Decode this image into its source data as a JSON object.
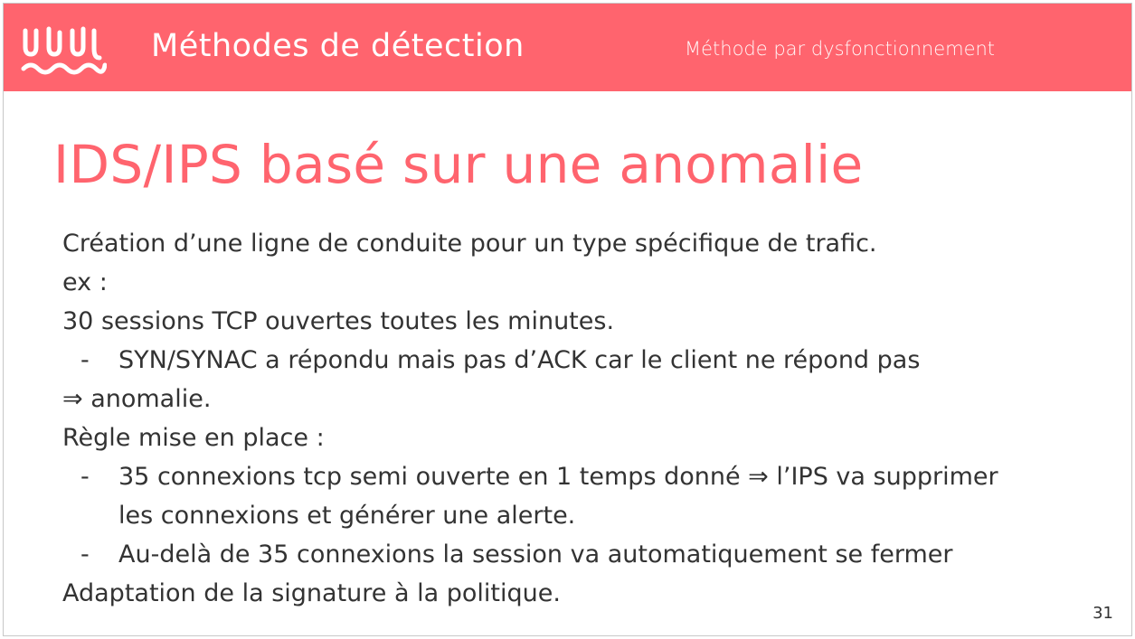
{
  "header": {
    "title": "Méthodes de détection",
    "subtitle": "Méthode par dysfonctionnement",
    "brand_color": "#ff646e"
  },
  "slide": {
    "title": "IDS/IPS basé sur une anomalie",
    "page_number": "31"
  },
  "content": {
    "line1": "Création d’une ligne de conduite pour un type spécifique de trafic.",
    "line2": "ex :",
    "line3": "30 sessions TCP ouvertes toutes les minutes.",
    "bullet1": "SYN/SYNAC a répondu mais pas d’ACK car le client ne répond pas",
    "line4": "⇒ anomalie.",
    "line5": "Règle mise en place :",
    "bullet2_line1": "35 connexions tcp semi ouverte en 1 temps donné ⇒ l’IPS va supprimer",
    "bullet2_line2": "les connexions et générer une alerte.",
    "bullet3": "Au-delà de 35 connexions la session va automatiquement se fermer",
    "line6": "Adaptation de la signature à la politique.",
    "dash": "-"
  },
  "icons": {
    "logo": "wavy-lines-logo-icon"
  }
}
